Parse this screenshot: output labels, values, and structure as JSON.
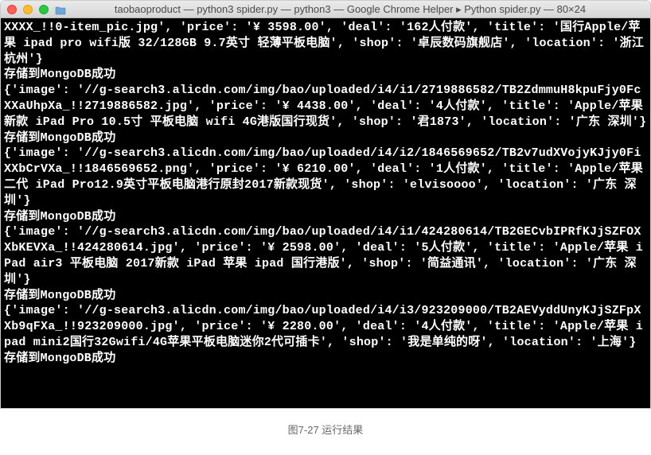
{
  "window": {
    "title": "taobaoproduct — python3 spider.py — python3 — Google Chrome Helper ▸ Python spider.py — 80×24"
  },
  "terminal": {
    "lines": [
      "XXXX_!!0-item_pic.jpg', 'price': '¥ 3598.00', 'deal': '162人付款', 'title': '国行Apple/苹果 ipad pro wifi版 32/128GB 9.7英寸 轻薄平板电脑', 'shop': '卓辰数码旗舰店', 'location': '浙江 杭州'}",
      "存储到MongoDB成功",
      "{'image': '//g-search3.alicdn.com/img/bao/uploaded/i4/i1/2719886582/TB2ZdmmuH8kpuFjy0FcXXaUhpXa_!!2719886582.jpg', 'price': '¥ 4438.00', 'deal': '4人付款', 'title': 'Apple/苹果 新款 iPad Pro 10.5寸 平板电脑 wifi 4G港版国行现货', 'shop': '君1873', 'location': '广东 深圳'}",
      "存储到MongoDB成功",
      "{'image': '//g-search3.alicdn.com/img/bao/uploaded/i4/i2/1846569652/TB2v7udXVojyKJjy0FiXXbCrVXa_!!1846569652.png', 'price': '¥ 6210.00', 'deal': '1人付款', 'title': 'Apple/苹果 二代 iPad Pro12.9英寸平板电脑港行原封2017新款现货', 'shop': 'elvisoooo', 'location': '广东 深圳'}",
      "存储到MongoDB成功",
      "{'image': '//g-search3.alicdn.com/img/bao/uploaded/i4/i1/424280614/TB2GECvbIPRfKJjSZFOXXbKEVXa_!!424280614.jpg', 'price': '¥ 2598.00', 'deal': '5人付款', 'title': 'Apple/苹果 iPad air3 平板电脑 2017新款 iPad 苹果 ipad 国行港版', 'shop': '简益通讯', 'location': '广东 深圳'}",
      "存储到MongoDB成功",
      "{'image': '//g-search3.alicdn.com/img/bao/uploaded/i4/i3/923209000/TB2AEVyddUnyKJjSZFpXXb9qFXa_!!923209000.jpg', 'price': '¥ 2280.00', 'deal': '4人付款', 'title': 'Apple/苹果 ipad mini2国行32Gwifi/4G苹果平板电脑迷你2代可插卡', 'shop': '我是单纯的呀', 'location': '上海'}",
      "存储到MongoDB成功"
    ]
  },
  "caption": "图7-27 运行结果"
}
